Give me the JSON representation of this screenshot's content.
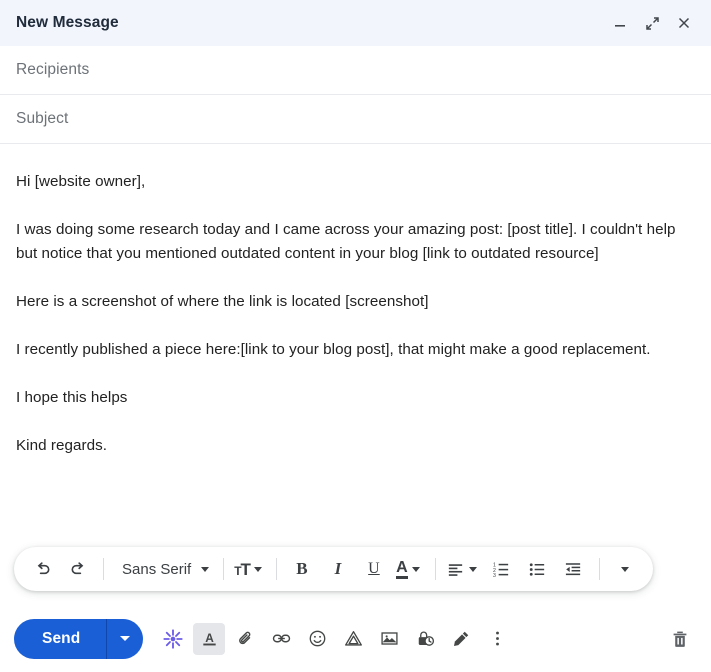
{
  "window": {
    "title": "New Message",
    "controls": [
      {
        "name": "minimize",
        "icon": "minimize-icon"
      },
      {
        "name": "expand",
        "icon": "expand-icon"
      },
      {
        "name": "close",
        "icon": "close-icon"
      }
    ]
  },
  "fields": {
    "recipients_placeholder": "Recipients",
    "subject_placeholder": "Subject"
  },
  "body": {
    "paragraphs": [
      "Hi [website owner],",
      "I was doing some research today and I came across your amazing post: [post title]. I couldn't help but notice that you mentioned outdated content in your blog [link to outdated resource]",
      "Here is a screenshot of where the link is located [screenshot]",
      "I recently published a piece here:[link to your blog post], that might make a good replacement.",
      "I hope this helps",
      "Kind regards."
    ]
  },
  "format_toolbar": {
    "undo_label": "undo-icon",
    "redo_label": "redo-icon",
    "font_family": "Sans Serif",
    "font_size_label": "TT",
    "bold_label": "B",
    "italic_label": "I",
    "underline_label": "U",
    "text_color_label": "A",
    "align_label": "align-left-icon",
    "numbered_list_label": "numbered-list-icon",
    "bulleted_list_label": "bulleted-list-icon",
    "indent_less_label": "indent-less-icon",
    "more_label": "more-format-icon"
  },
  "bottom_bar": {
    "send_label": "Send",
    "send_options_label": "send-options-icon",
    "icons": [
      {
        "name": "gemini-help-me-write-icon",
        "active": false,
        "color": "#6b5ce7"
      },
      {
        "name": "formatting-options-icon",
        "active": true
      },
      {
        "name": "attach-file-icon",
        "active": false
      },
      {
        "name": "insert-link-icon",
        "active": false
      },
      {
        "name": "insert-emoji-icon",
        "active": false
      },
      {
        "name": "insert-drive-file-icon",
        "active": false
      },
      {
        "name": "insert-photo-icon",
        "active": false
      },
      {
        "name": "confidential-mode-icon",
        "active": false
      },
      {
        "name": "insert-signature-icon",
        "active": false
      },
      {
        "name": "more-options-icon",
        "active": false
      }
    ],
    "discard_label": "discard-draft-icon"
  },
  "colors": {
    "header_bg": "#f2f6fc",
    "send_blue": "#1a5fd6",
    "gemini_purple": "#6b5ce7",
    "text": "#222222",
    "placeholder": "#6c7277"
  }
}
